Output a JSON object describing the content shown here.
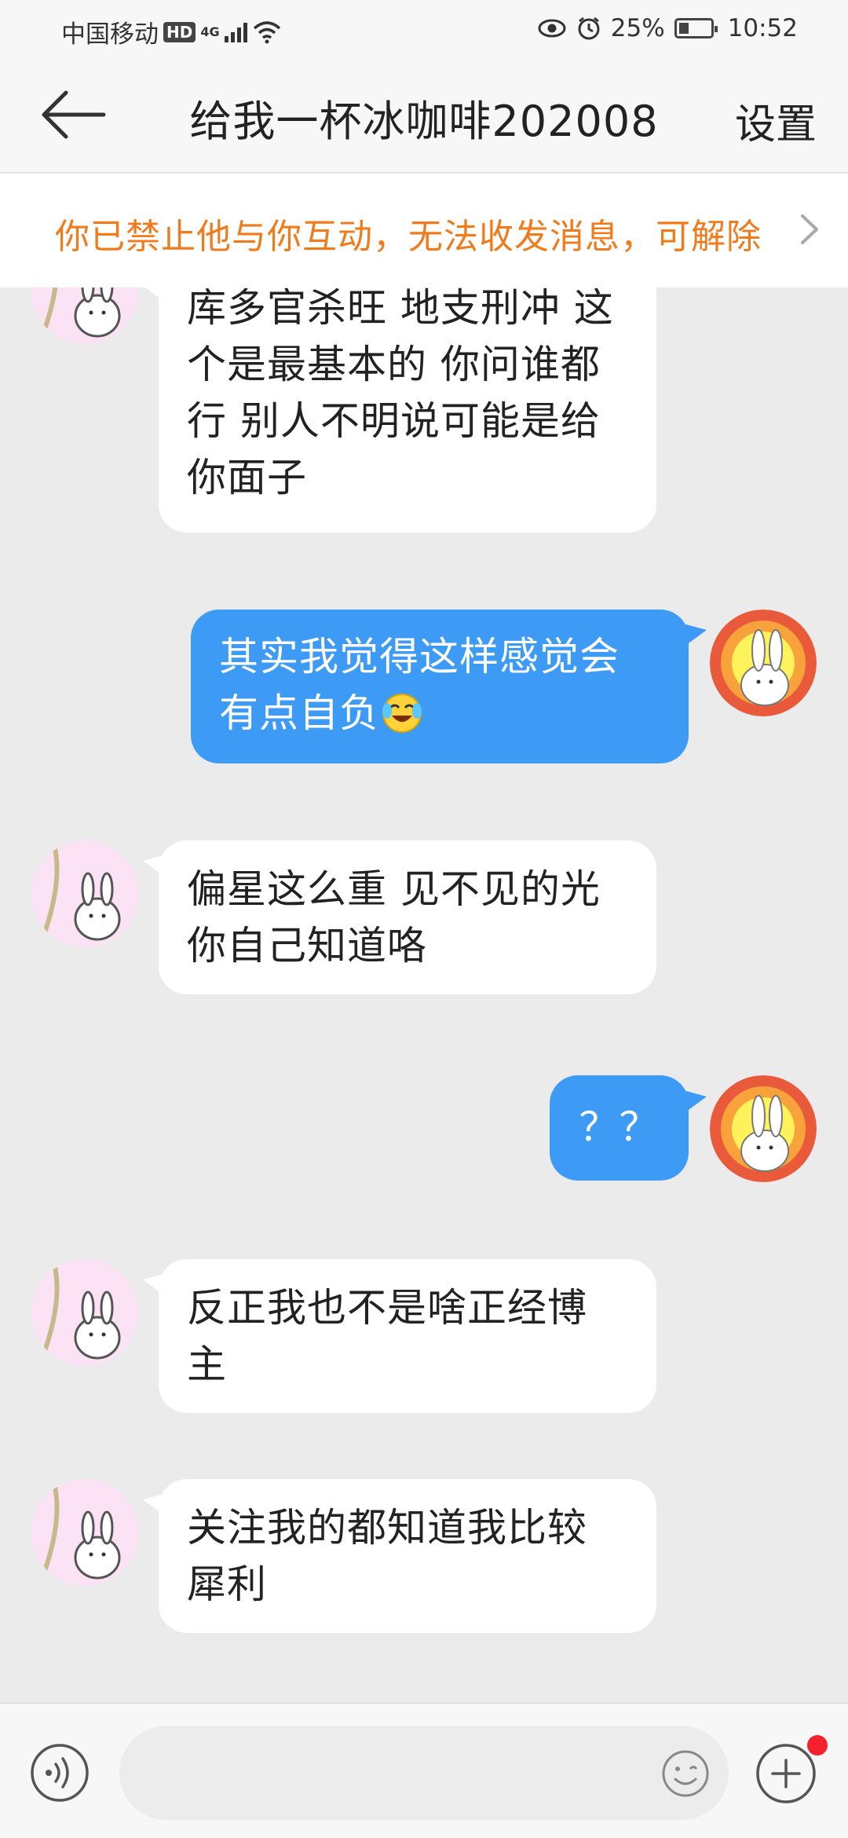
{
  "status_bar": {
    "carrier": "中国移动",
    "hd": "HD",
    "network": "4G",
    "battery": "25%",
    "time": "10:52",
    "icons": [
      "eye-icon",
      "alarm-icon",
      "wifi-icon",
      "signal-icon",
      "battery-icon"
    ]
  },
  "header": {
    "title": "给我一杯冰咖啡202008",
    "settings_label": "设置"
  },
  "banner": {
    "text": "你已禁止他与你互动，无法收发消息，可解除"
  },
  "messages": [
    {
      "from": "other",
      "lines": [
        "库多官杀旺 地支刑冲 这",
        "个是最基本的 你问谁都",
        "行 别人不明说可能是给",
        "你面子"
      ]
    },
    {
      "from": "me",
      "lines": [
        "其实我觉得这样感觉会",
        "有点自负"
      ],
      "emoji": "laughing-tears-emoji"
    },
    {
      "from": "other",
      "lines": [
        "偏星这么重 见不见的光",
        "你自己知道咯"
      ]
    },
    {
      "from": "me",
      "lines": [
        "？？"
      ]
    },
    {
      "from": "other",
      "lines": [
        "反正我也不是啥正经博",
        "主"
      ]
    },
    {
      "from": "other",
      "lines": [
        "关注我的都知道我比较",
        "犀利"
      ]
    }
  ],
  "input_bar": {
    "placeholder": "",
    "icons": [
      "voice-icon",
      "emoji-icon",
      "plus-icon"
    ]
  },
  "colors": {
    "accent_blue": "#3d9bf5",
    "banner_orange": "#f07b1d",
    "notif_red": "#f5222d",
    "chat_bg": "#ebebeb"
  }
}
